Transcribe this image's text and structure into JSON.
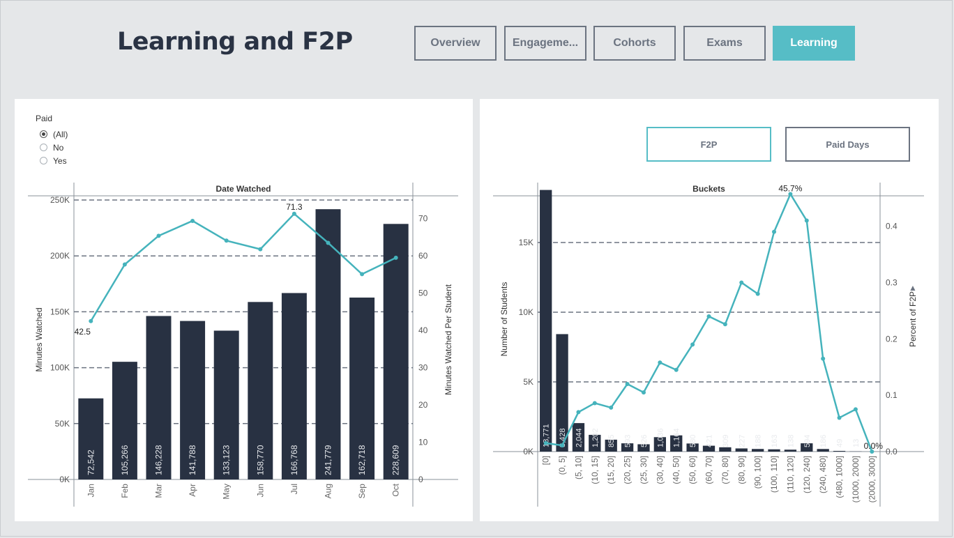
{
  "header": {
    "title": "Learning and F2P"
  },
  "nav": [
    {
      "label": "Overview",
      "active": false
    },
    {
      "label": "Engageme...",
      "active": false
    },
    {
      "label": "Cohorts",
      "active": false
    },
    {
      "label": "Exams",
      "active": false
    },
    {
      "label": "Learning",
      "active": true
    }
  ],
  "filter": {
    "title": "Paid",
    "options": [
      {
        "label": "(All)",
        "selected": true
      },
      {
        "label": "No",
        "selected": false
      },
      {
        "label": "Yes",
        "selected": false
      }
    ]
  },
  "toggles": {
    "f2p_label": "F2P",
    "paid_days_label": "Paid Days"
  },
  "colors": {
    "bar": "#283142",
    "line": "#45b3bc",
    "accent": "#56bdc6",
    "grid": "#6b7380"
  },
  "chart_data": [
    {
      "type": "bar",
      "title": "Date Watched",
      "categories": [
        "Jan",
        "Feb",
        "Mar",
        "Apr",
        "May",
        "Jun",
        "Jul",
        "Aug",
        "Sep",
        "Oct"
      ],
      "series": [
        {
          "name": "Minutes Watched",
          "values": [
            72542,
            105266,
            146228,
            141788,
            133123,
            158770,
            166768,
            241779,
            162718,
            228609
          ],
          "labels": [
            "72,542",
            "105,266",
            "146,228",
            "141,788",
            "133,123",
            "158,770",
            "166,768",
            "241,779",
            "162,718",
            "228,609"
          ]
        },
        {
          "name": "Minutes Watched Per Student",
          "values": [
            42.5,
            57.7,
            65.4,
            69.4,
            64.1,
            61.8,
            71.3,
            63.5,
            55.1,
            59.5
          ]
        }
      ],
      "annotations": [
        "42.5",
        "71.3"
      ],
      "ylabel": "Minutes Watched",
      "y2label": "Minutes Watched Per Student",
      "ylim": [
        0,
        250000
      ],
      "y2lim": [
        0,
        75
      ],
      "yticks": [
        "0K",
        "50K",
        "100K",
        "150K",
        "200K",
        "250K"
      ],
      "y2ticks": [
        "0",
        "10",
        "20",
        "30",
        "40",
        "50",
        "60",
        "70"
      ],
      "grid": true
    },
    {
      "type": "bar",
      "title": "Buckets",
      "categories": [
        "[0]",
        "(0, 5]",
        "(5, 10]",
        "(10, 15]",
        "(15, 20]",
        "(20, 25]",
        "(25, 30]",
        "(30, 40]",
        "(40, 50]",
        "(50, 60]",
        "(60, 70]",
        "(70, 80]",
        "(80, 90]",
        "(90, 100]",
        "(100, 110]",
        "(110, 120]",
        "(120, 240]",
        "(240, 480]",
        "(480, 1000]",
        "(1000, 2000]",
        "(2000, 3000]"
      ],
      "series": [
        {
          "name": "Number of Students",
          "values": [
            18771,
            8428,
            2044,
            1202,
            855,
            593,
            526,
            1036,
            1164,
            580,
            421,
            309,
            227,
            188,
            163,
            138,
            594,
            186,
            49,
            13,
            0
          ],
          "labels": [
            "18,771",
            "8,428",
            "2,044",
            "1,202",
            "855",
            "593",
            "526",
            "1,036",
            "1,164",
            "580",
            "421",
            "309",
            "227",
            "188",
            "163",
            "138",
            "594",
            "186",
            "49",
            "13",
            ""
          ]
        },
        {
          "name": "Percent of F2P",
          "values": [
            0.015,
            0.011,
            0.07,
            0.086,
            0.078,
            0.12,
            0.105,
            0.158,
            0.145,
            0.19,
            0.24,
            0.226,
            0.3,
            0.28,
            0.39,
            0.457,
            0.41,
            0.165,
            0.06,
            0.075,
            0.0
          ]
        }
      ],
      "annotations": [
        "45.7%",
        "0.0%"
      ],
      "ylabel": "Number of Students",
      "y2label": "Percent of F2P",
      "ylim": [
        0,
        19000
      ],
      "y2lim": [
        0,
        0.47
      ],
      "yticks": [
        "0K",
        "5K",
        "10K",
        "15K"
      ],
      "y2ticks": [
        "0.0",
        "0.1",
        "0.2",
        "0.3",
        "0.4"
      ],
      "grid": true
    }
  ]
}
